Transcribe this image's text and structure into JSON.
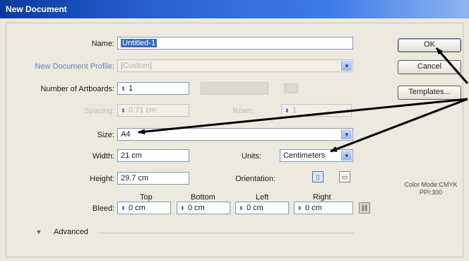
{
  "window": {
    "title": "New Document"
  },
  "form": {
    "name_label": "Name:",
    "name_value": "Untitled-1",
    "profile_label": "New Document Profile:",
    "profile_value": "[Custom]",
    "artboards_label": "Number of Artboards:",
    "artboards_value": "1",
    "spacing_label": "Spacing:",
    "spacing_value": "0.71 cm",
    "columns_label": "Rows:",
    "columns_value": "1",
    "size_label": "Size:",
    "size_value": "A4",
    "width_label": "Width:",
    "width_value": "21 cm",
    "units_label": "Units:",
    "units_value": "Centimeters",
    "height_label": "Height:",
    "height_value": "29.7 cm",
    "orientation_label": "Orientation:",
    "bleed_label": "Bleed:",
    "bleed_top_label": "Top",
    "bleed_top_value": "0 cm",
    "bleed_bottom_label": "Bottom",
    "bleed_bottom_value": "0 cm",
    "bleed_left_label": "Left",
    "bleed_left_value": "0 cm",
    "bleed_right_label": "Right",
    "bleed_right_value": "0 cm",
    "advanced_label": "Advanced"
  },
  "buttons": {
    "ok": "OK",
    "cancel": "Cancel",
    "templates": "Templates..."
  },
  "info": {
    "color_mode": "Color Mode:CMYK",
    "ppi": "PPI:300"
  },
  "icons": {
    "spin": "spin-arrows-icon",
    "dropdown": "chevron-down-icon",
    "portrait": "portrait-orientation-icon",
    "landscape": "landscape-orientation-icon",
    "link": "chain-link-icon",
    "expand": "expand-triangle-icon"
  },
  "colors": {
    "title_bar": "#0a3a9e",
    "selection": "#316ac5",
    "field_border": "#7f9db9",
    "annotation_arrow": "#000000"
  }
}
